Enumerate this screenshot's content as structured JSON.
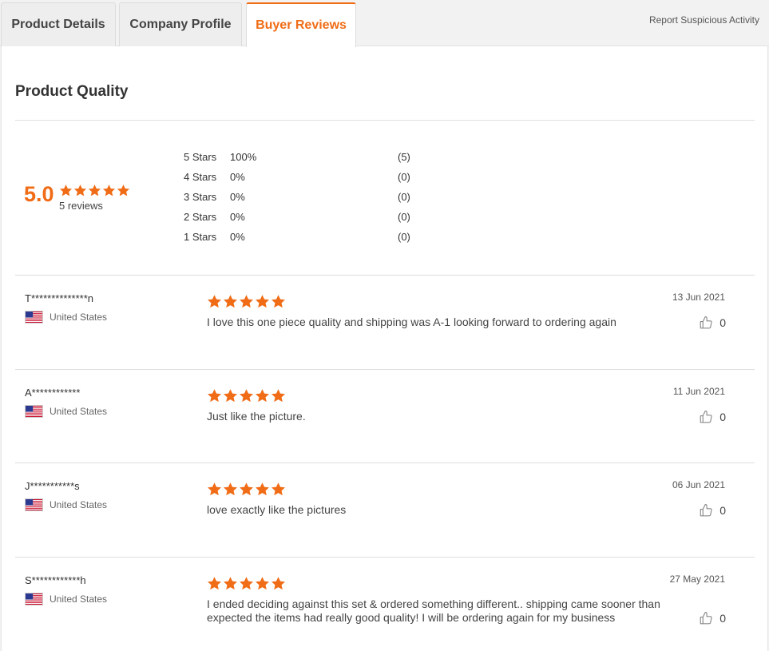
{
  "tabs": [
    {
      "label": "Product Details"
    },
    {
      "label": "Company Profile"
    },
    {
      "label": "Buyer Reviews"
    }
  ],
  "report_link": "Report Suspicious Activity",
  "section_title": "Product Quality",
  "rating_summary": {
    "average": "5.0",
    "average_stars": 5,
    "count_label": "5 reviews",
    "distribution": [
      {
        "label": "5 Stars",
        "percent": "100%",
        "count": "(5)"
      },
      {
        "label": "4 Stars",
        "percent": "0%",
        "count": "(0)"
      },
      {
        "label": "3 Stars",
        "percent": "0%",
        "count": "(0)"
      },
      {
        "label": "2 Stars",
        "percent": "0%",
        "count": "(0)"
      },
      {
        "label": "1 Stars",
        "percent": "0%",
        "count": "(0)"
      }
    ]
  },
  "colors": {
    "accent": "#f06c16"
  },
  "icons": {
    "star": "star-icon",
    "flag": "us-flag-icon",
    "like": "thumbs-up-icon"
  },
  "reviews": [
    {
      "name": "T**************n",
      "country": "United States",
      "rating": 5,
      "text": "I love this one piece quality and shipping was A-1 looking forward to ordering again",
      "date": "13 Jun 2021",
      "likes": "0"
    },
    {
      "name": "A************",
      "country": "United States",
      "rating": 5,
      "text": "Just like the picture.",
      "date": "11 Jun 2021",
      "likes": "0"
    },
    {
      "name": "J***********s",
      "country": "United States",
      "rating": 5,
      "text": "love exactly like the pictures",
      "date": "06 Jun 2021",
      "likes": "0"
    },
    {
      "name": "S************h",
      "country": "United States",
      "rating": 5,
      "text": "I ended deciding against this set & ordered something different.. shipping came sooner than expected the items had really good quality! I will be ordering again for my business",
      "date": "27 May 2021",
      "likes": "0"
    }
  ]
}
